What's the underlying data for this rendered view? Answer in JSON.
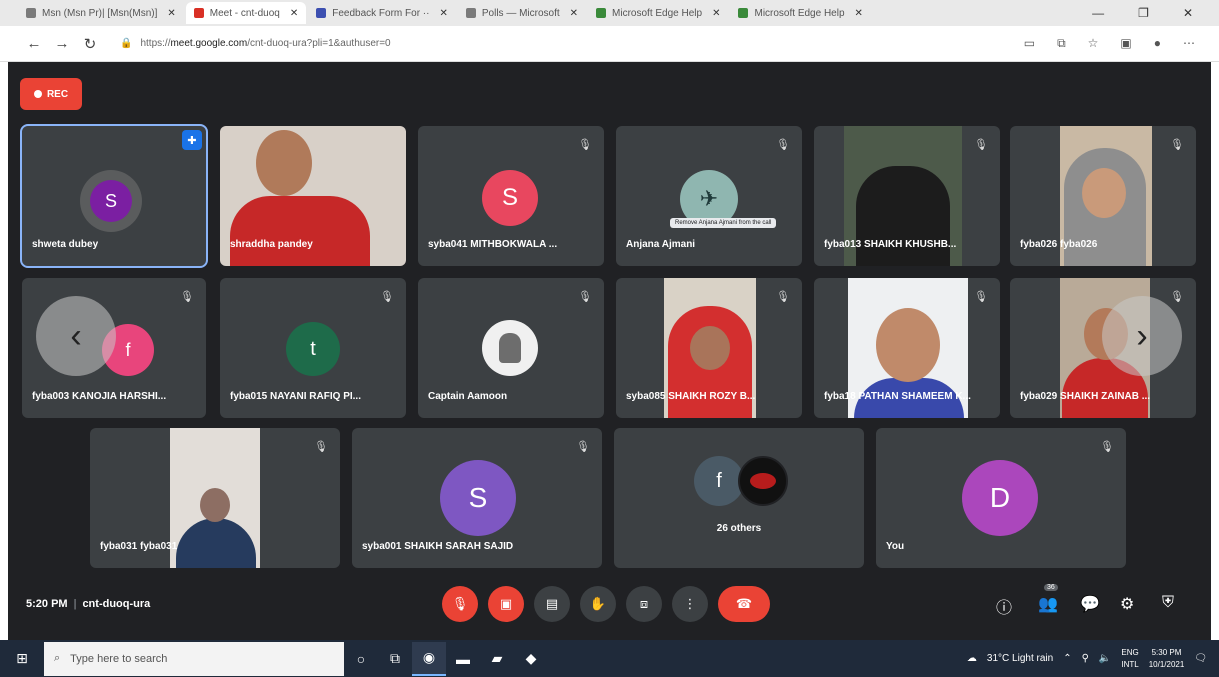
{
  "browser": {
    "tabs": [
      {
        "label": "Msn (Msn Pr)| [Msn(Msn)]",
        "fav": "grey"
      },
      {
        "label": "Meet - cnt-duoq",
        "fav": "red",
        "active": true
      },
      {
        "label": "Feedback Form For ··",
        "fav": "blue"
      },
      {
        "label": "Polls — Microsoft",
        "fav": "grey"
      },
      {
        "label": "Microsoft Edge Help",
        "fav": "green"
      },
      {
        "label": "Microsoft Edge Help",
        "fav": "green"
      }
    ],
    "window_controls": [
      "—",
      "❐",
      "✕"
    ],
    "url_host": "meet.google.com",
    "url_path": "/cnt-duoq-ura?pli=1&authuser=0",
    "url_prefix": "https://"
  },
  "meet": {
    "rec_label": "REC",
    "tiles": [
      {
        "name": "shweta dubey",
        "avatar_letter": "S",
        "avatar_color": "#7b1fa2",
        "pinned": true
      },
      {
        "name": "shraddha pandey",
        "type": "video"
      },
      {
        "name": "syba041 MITHBOKWALA ...",
        "avatar_letter": "S",
        "avatar_color": "#e8475f"
      },
      {
        "name": "Anjana Ajmani",
        "type": "logo",
        "tooltip": "Remove Anjana Ajmani from the call"
      },
      {
        "name": "fyba013 SHAIKH KHUSHB...",
        "type": "video"
      },
      {
        "name": "fyba026 fyba026",
        "type": "video"
      },
      {
        "name": "fyba003 KANOJIA HARSHI...",
        "avatar_letter": "f",
        "avatar_color": "#e8457c"
      },
      {
        "name": "fyba015 NAYANI RAFIQ PI...",
        "avatar_letter": "t",
        "avatar_color": "#1e6b4a"
      },
      {
        "name": "Captain Aamoon",
        "type": "photo"
      },
      {
        "name": "syba085 SHAIKH ROZY B...",
        "type": "video"
      },
      {
        "name": "fyba18 PATHAN SHAMEEM K...",
        "type": "video"
      },
      {
        "name": "fyba029 SHAIKH ZAINAB ...",
        "type": "video"
      },
      {
        "name": "fyba031 fyba031",
        "type": "video"
      },
      {
        "name": "syba001 SHAIKH SARAH SAJID",
        "avatar_letter": "S",
        "avatar_color": "#7e57c2"
      },
      {
        "name": "26 others",
        "type": "others",
        "avatar_letter": "f"
      },
      {
        "name": "You",
        "avatar_letter": "D",
        "avatar_color": "#ab47bc"
      }
    ],
    "time": "5:20 PM",
    "meeting_code": "cnt-duoq-ura",
    "participant_count": "36",
    "prev_arrow": "‹",
    "next_arrow": "›"
  },
  "taskbar": {
    "search_placeholder": "Type here to search",
    "weather": "31°C  Light rain",
    "lang_line1": "ENG",
    "lang_line2": "INTL",
    "time": "5:30 PM",
    "date": "10/1/2021"
  }
}
